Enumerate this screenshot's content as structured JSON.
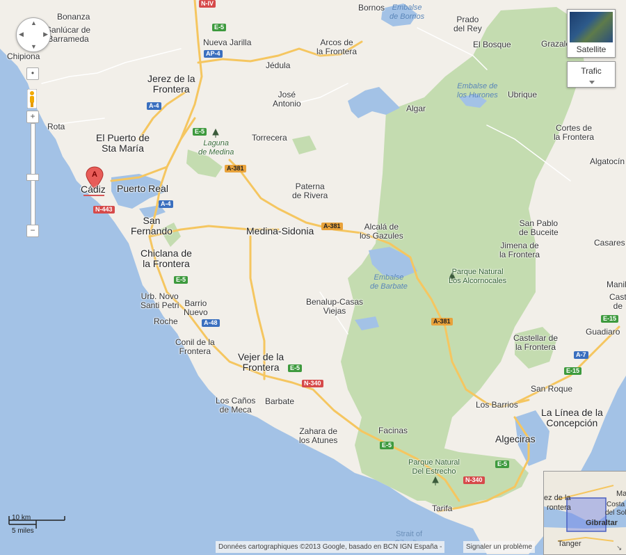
{
  "map": {
    "cities": [
      {
        "name": "Bonanza",
        "cls": ""
      },
      {
        "name": "Sanlúcar de\nBarrameda",
        "cls": ""
      },
      {
        "name": "Chipiona",
        "cls": ""
      },
      {
        "name": "Bornos",
        "cls": ""
      },
      {
        "name": "Prado\ndel Rey",
        "cls": ""
      },
      {
        "name": "El Bosque",
        "cls": ""
      },
      {
        "name": "Grazale",
        "cls": ""
      },
      {
        "name": "Nueva Jarilla",
        "cls": ""
      },
      {
        "name": "Arcos de\nla Frontera",
        "cls": ""
      },
      {
        "name": "Jédula",
        "cls": ""
      },
      {
        "name": "Jerez de la\nFrontera",
        "cls": "big"
      },
      {
        "name": "José\nAntonio",
        "cls": ""
      },
      {
        "name": "Algar",
        "cls": ""
      },
      {
        "name": "Ubrique",
        "cls": ""
      },
      {
        "name": "Rota",
        "cls": ""
      },
      {
        "name": "El Puerto de\nSta María",
        "cls": "big"
      },
      {
        "name": "Torrecera",
        "cls": ""
      },
      {
        "name": "Cortes de\nla Frontera",
        "cls": ""
      },
      {
        "name": "Algatocín",
        "cls": ""
      },
      {
        "name": "Cádiz",
        "cls": "big"
      },
      {
        "name": "Puerto Real",
        "cls": "big"
      },
      {
        "name": "Paterna\nde Rivera",
        "cls": ""
      },
      {
        "name": "San\nFernando",
        "cls": "big"
      },
      {
        "name": "Medina-Sidonia",
        "cls": "big"
      },
      {
        "name": "Alcalá de\nlos Gazules",
        "cls": ""
      },
      {
        "name": "San Pablo\nde Buceite",
        "cls": ""
      },
      {
        "name": "Chiclana de\nla Frontera",
        "cls": "big"
      },
      {
        "name": "Jimena de\nla Frontera",
        "cls": ""
      },
      {
        "name": "Casares",
        "cls": ""
      },
      {
        "name": "Manily",
        "cls": ""
      },
      {
        "name": "Urb. Novo\nSanti Petri",
        "cls": ""
      },
      {
        "name": "Barrio\nNuevo",
        "cls": ""
      },
      {
        "name": "Benalup-Casas\nViejas",
        "cls": ""
      },
      {
        "name": "Cast\nde",
        "cls": ""
      },
      {
        "name": "Roche",
        "cls": ""
      },
      {
        "name": "Guadiaro",
        "cls": ""
      },
      {
        "name": "Conil de la\nFrontera",
        "cls": ""
      },
      {
        "name": "Castellar de\nla Frontera",
        "cls": ""
      },
      {
        "name": "Vejer de la\nFrontera",
        "cls": "big"
      },
      {
        "name": "San Roque",
        "cls": ""
      },
      {
        "name": "Los Caños\nde Meca",
        "cls": ""
      },
      {
        "name": "Barbate",
        "cls": ""
      },
      {
        "name": "Los Barrios",
        "cls": ""
      },
      {
        "name": "La Línea de la\nConcepción",
        "cls": "big"
      },
      {
        "name": "Facinas",
        "cls": ""
      },
      {
        "name": "Zahara de\nlos Atunes",
        "cls": ""
      },
      {
        "name": "Algeciras",
        "cls": "big"
      },
      {
        "name": "Tarifa",
        "cls": ""
      }
    ],
    "parks": [
      {
        "name": "Laguna\nde Medina",
        "cls": "park"
      },
      {
        "name": "Parque Natural\nLos Alcornocales",
        "cls": "parkbig"
      },
      {
        "name": "Parque Natural\nDel Estrecho",
        "cls": "parkbig"
      }
    ],
    "waters": [
      {
        "name": "Embalse\nde Bornos",
        "cls": "water"
      },
      {
        "name": "Embalse de\nlos Hurones",
        "cls": "water"
      },
      {
        "name": "Embalse\nde Barbate",
        "cls": "water"
      },
      {
        "name": "Strait of\nGibraltar",
        "cls": "sea"
      }
    ],
    "roads": [
      {
        "label": "N-IV",
        "color": "red"
      },
      {
        "label": "E-5",
        "color": "green"
      },
      {
        "label": "AP-4",
        "color": "blue"
      },
      {
        "label": "A-4",
        "color": "blue"
      },
      {
        "label": "E-5",
        "color": "green"
      },
      {
        "label": "A-381",
        "color": "orange"
      },
      {
        "label": "N-443",
        "color": "red"
      },
      {
        "label": "A-4",
        "color": "blue"
      },
      {
        "label": "A-381",
        "color": "orange"
      },
      {
        "label": "E-5",
        "color": "green"
      },
      {
        "label": "A-48",
        "color": "blue"
      },
      {
        "label": "E-5",
        "color": "green"
      },
      {
        "label": "N-340",
        "color": "red"
      },
      {
        "label": "A-381",
        "color": "orange"
      },
      {
        "label": "E-15",
        "color": "green"
      },
      {
        "label": "A-7",
        "color": "blue"
      },
      {
        "label": "E-15",
        "color": "green"
      },
      {
        "label": "E-5",
        "color": "green"
      },
      {
        "label": "E-5",
        "color": "green"
      },
      {
        "label": "N-340",
        "color": "red"
      }
    ],
    "marker_letter": "A"
  },
  "controls": {
    "satellite_label": "Satellite",
    "traffic_label": "Trafic",
    "zoom_in": "+",
    "zoom_out": "−"
  },
  "scale": {
    "km": "10 km",
    "miles": "5 miles"
  },
  "footer": {
    "attribution": "Données cartographiques ©2013 Google, basado en BCN IGN España -",
    "report": "Signaler un problème"
  },
  "overview": {
    "labels": [
      "Ma",
      "ez de la",
      "rontera",
      "Costa",
      "del Sol",
      "Gibraltar",
      "Tanger"
    ]
  }
}
